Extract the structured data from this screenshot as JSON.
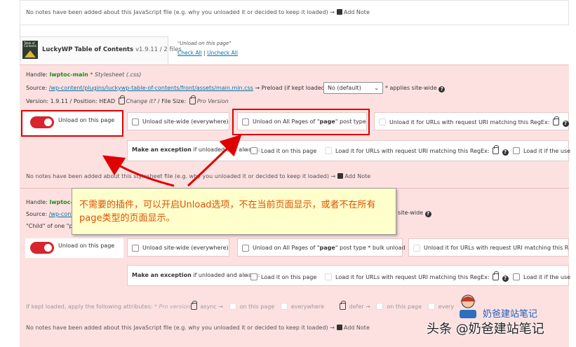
{
  "top": {
    "note_text": "No notes have been added about this JavaScript file (e.g. why you unloaded it or decided to keep it loaded) →",
    "add_note_label": "Add Note"
  },
  "plugin": {
    "logo_text": "Table of Contents",
    "name": "LuckyWP Table of Contents",
    "meta": "v1.9.11 / 2 files",
    "unload_hint": "\"Unload on this page\"",
    "check_all": "Check All",
    "separator": "|",
    "uncheck_all": "Uncheck All"
  },
  "asset1": {
    "handle_label": "Handle:",
    "handle": "lwptoc-main",
    "handle_type": "* Stylesheet (.css)",
    "source_label": "Source:",
    "source_path": "/wp-content/plugins/luckywp-table-of-contents/front/assets/main.min.css",
    "preload_label": "→  Preload (if kept loaded)?",
    "preload_value": "No (default)",
    "preload_note": "* applies site-wide",
    "version_line_a": "Version: 1.9.11  /  Position: HEAD",
    "change_it": "Change it?",
    "file_size": "/  File Size:",
    "pro_version": "Pro Version",
    "unload_on_page": "Unload on this page",
    "unload_site_wide": "Unload site-wide (everywhere)",
    "unload_post_type_pre": "Unload on All Pages of \"",
    "post_type": "page",
    "unload_post_type_post": "\" post type",
    "unload_regex": "Unload it for URLs with request URI matching this RegEx:",
    "exception_label_bold": "Make an exception",
    "exception_label_rest": "if unloaded and always:",
    "load_on_page": "Load it on this page",
    "load_regex": "Load it for URLs with request URI matching this RegEx:",
    "load_if_user": "Load it if the use",
    "note_text": "No notes have been added about this stylesheet file (e.g. why you unloaded it or decided to keep it loaded) →",
    "add_note_label": "Add Note"
  },
  "asset2": {
    "handle_label": "Handle:",
    "handle": "lwptoc-m",
    "source_label": "Source:",
    "source_path": "/wp-cont",
    "child_of": "\"Child\" of one \"pa",
    "site_wide_tail": "site-wide",
    "unload_on_page": "Unload on this page",
    "unload_site_wide": "Unload site-wide (everywhere)",
    "unload_post_type_pre": "Unload on All Pages of \"",
    "post_type": "page",
    "unload_post_type_post": "\" post type",
    "bulk_unload": "* bulk unload",
    "unload_regex": "Unload it for URLs with request URI matching this RegEx",
    "exception_label_bold": "Make an exception",
    "exception_label_rest": "if unloaded and always:",
    "load_on_page": "Load it on this page",
    "load_regex": "Load it for URLs with request URI matching this RegEx:",
    "load_if_user": "Load it if the use",
    "attr_label": "If kept loaded, apply the following attributes:",
    "attr_pro": "* Pro version",
    "async": "async →",
    "on_this_page": "on this page",
    "everywhere": "everywhere",
    "defer": "defer →",
    "on_this_page2": "on this page",
    "every2": "every",
    "note_text": "No notes have been added about this JavaScript file (e.g. why you unloaded it or decided to keep it loaded) →",
    "add_note_label": "Add Note"
  },
  "callout": {
    "text": "不需要的插件，可以开启Unload选项，不在当前页面显示，或者不在所有page类型的页面显示。"
  },
  "watermark": {
    "small": "奶爸建站笔记",
    "large": "头条 @奶爸建站笔记"
  },
  "colors": {
    "accent_red": "#e00000",
    "toggle_red": "#d9232f",
    "callout_bg": "#ffffcc",
    "callout_text": "#e05000",
    "row_bg": "#fde1e1",
    "link": "#0073aa",
    "handle_green": "#1d8c1d"
  },
  "icons": [
    "lock-icon",
    "info-icon",
    "pen-icon",
    "chevron-down-icon",
    "arrow-icon"
  ]
}
